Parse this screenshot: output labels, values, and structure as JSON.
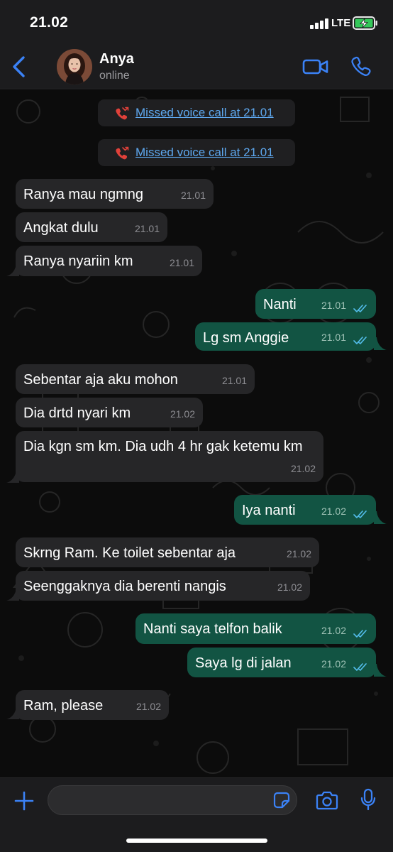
{
  "status_bar": {
    "time": "21.02",
    "network": "LTE",
    "battery_charging": true
  },
  "header": {
    "contact_name": "Anya",
    "contact_status": "online",
    "icons": {
      "back": "chevron-left-icon",
      "video": "video-camera-icon",
      "call": "phone-icon"
    }
  },
  "theme": {
    "accent": "#3b82f6",
    "incoming_bubble": "#262628",
    "outgoing_bubble": "#125443",
    "missed_call": "#e0413a",
    "link": "#5ea8ef"
  },
  "system_messages": [
    {
      "text": "Missed voice call at 21.01"
    },
    {
      "text": "Missed voice call at 21.01"
    }
  ],
  "messages": [
    {
      "dir": "in",
      "text": "Ranya mau ngmng",
      "time": "21.01"
    },
    {
      "dir": "in",
      "text": "Angkat dulu",
      "time": "21.01"
    },
    {
      "dir": "in",
      "text": "Ranya nyariin km",
      "time": "21.01"
    },
    {
      "dir": "out",
      "text": "Nanti",
      "time": "21.01",
      "status": "read"
    },
    {
      "dir": "out",
      "text": "Lg sm Anggie",
      "time": "21.01",
      "status": "read"
    },
    {
      "dir": "in",
      "text": "Sebentar aja aku mohon",
      "time": "21.01"
    },
    {
      "dir": "in",
      "text": "Dia drtd nyari km",
      "time": "21.02"
    },
    {
      "dir": "in",
      "text": "Dia kgn sm km. Dia udh 4 hr gak ketemu km",
      "time": "21.02"
    },
    {
      "dir": "out",
      "text": "Iya nanti",
      "time": "21.02",
      "status": "read"
    },
    {
      "dir": "in",
      "text": "Skrng Ram. Ke toilet sebentar aja",
      "time": "21.02"
    },
    {
      "dir": "in",
      "text": "Seenggaknya dia berenti nangis",
      "time": "21.02"
    },
    {
      "dir": "out",
      "text": "Nanti saya telfon balik",
      "time": "21.02",
      "status": "read"
    },
    {
      "dir": "out",
      "text": "Saya lg di jalan",
      "time": "21.02",
      "status": "read"
    },
    {
      "dir": "in",
      "text": "Ram, please",
      "time": "21.02"
    }
  ],
  "input_bar": {
    "placeholder": "",
    "icons": {
      "attach": "plus-icon",
      "sticker": "sticker-icon",
      "camera": "camera-icon",
      "mic": "microphone-icon"
    }
  }
}
